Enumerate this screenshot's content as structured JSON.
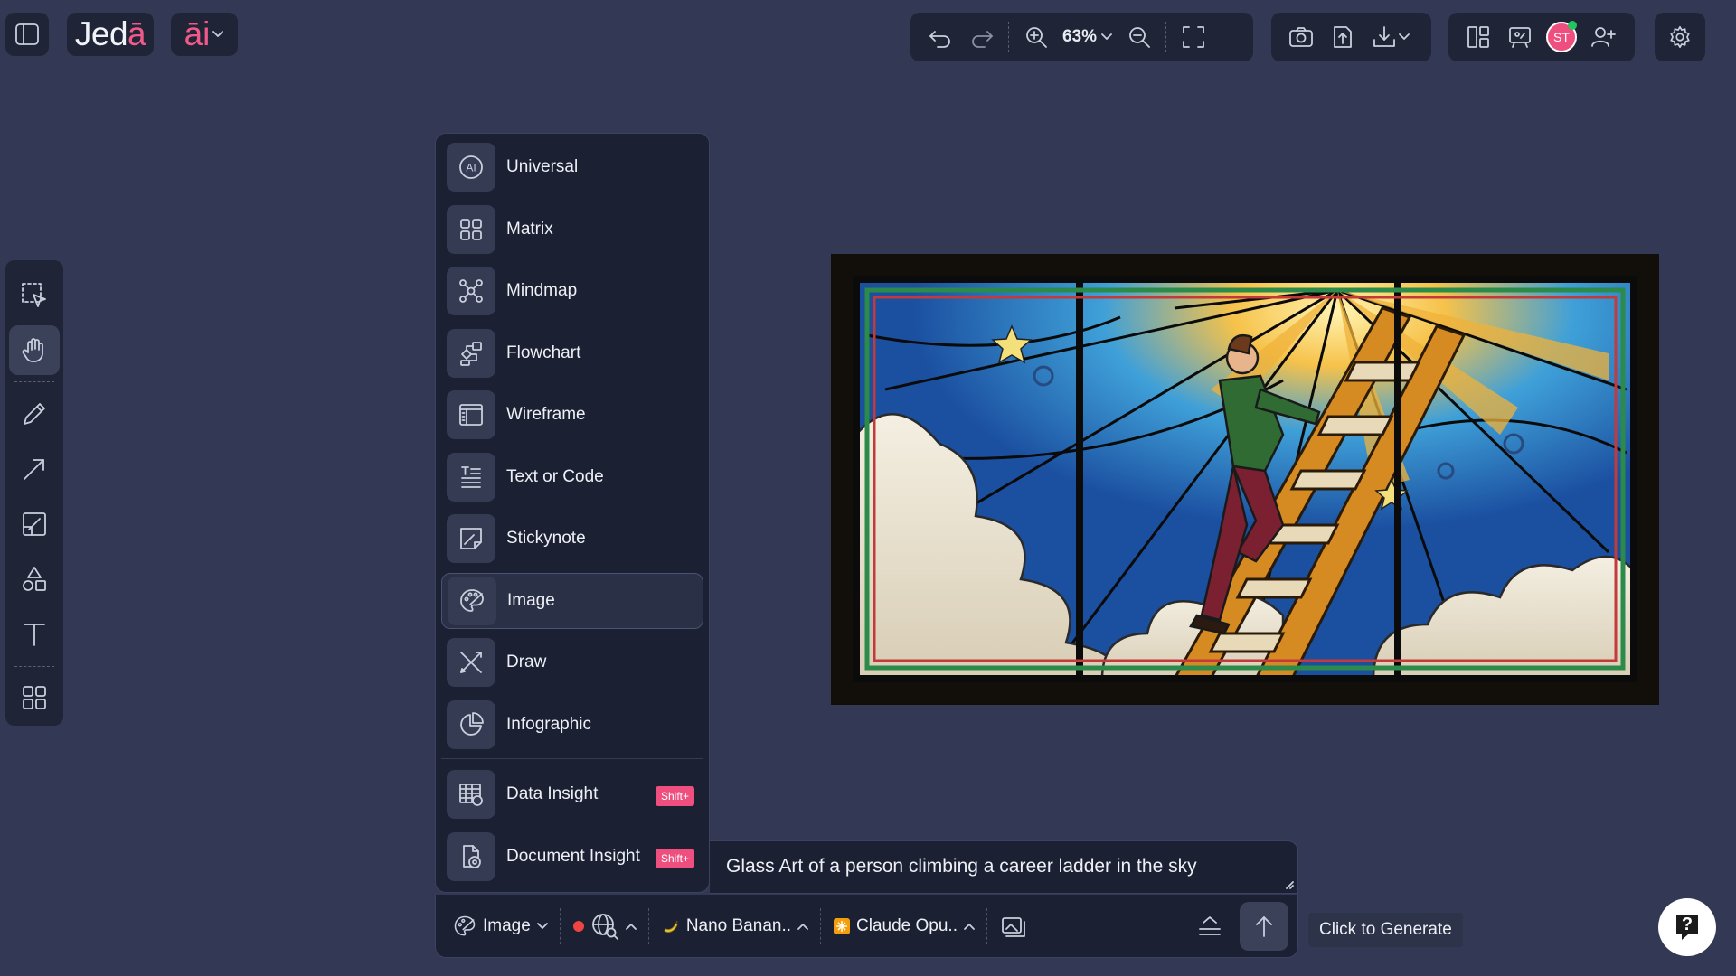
{
  "brand": {
    "name_pre": "Jed",
    "name_mac": "ā",
    "ai_label": "āi"
  },
  "toolbar": {
    "zoom_level": "63%"
  },
  "user": {
    "initials": "ST",
    "avatar_color": "#ef4f7e"
  },
  "type_menu": {
    "items": [
      {
        "label": "Universal",
        "icon": "ai-icon"
      },
      {
        "label": "Matrix",
        "icon": "grid-icon"
      },
      {
        "label": "Mindmap",
        "icon": "mindmap-icon"
      },
      {
        "label": "Flowchart",
        "icon": "flowchart-icon"
      },
      {
        "label": "Wireframe",
        "icon": "wireframe-icon"
      },
      {
        "label": "Text or Code",
        "icon": "text-icon"
      },
      {
        "label": "Stickynote",
        "icon": "stickynote-icon"
      },
      {
        "label": "Image",
        "icon": "palette-icon",
        "selected": true
      },
      {
        "label": "Draw",
        "icon": "draw-icon"
      },
      {
        "label": "Infographic",
        "icon": "pie-icon"
      }
    ],
    "premium_items": [
      {
        "label": "Data Insight",
        "icon": "data-table-icon",
        "badge": "Shift+"
      },
      {
        "label": "Document Insight",
        "icon": "document-icon",
        "badge": "Shift+"
      }
    ]
  },
  "prompt": {
    "text": "Glass Art of a person climbing a career ladder in the sky",
    "type_selector": "Image",
    "image_model": "Nano Banan..",
    "text_model": "Claude Opu..",
    "tooltip": "Click to Generate",
    "status_dot_color": "#ef4444"
  },
  "help": {
    "label": "?"
  }
}
